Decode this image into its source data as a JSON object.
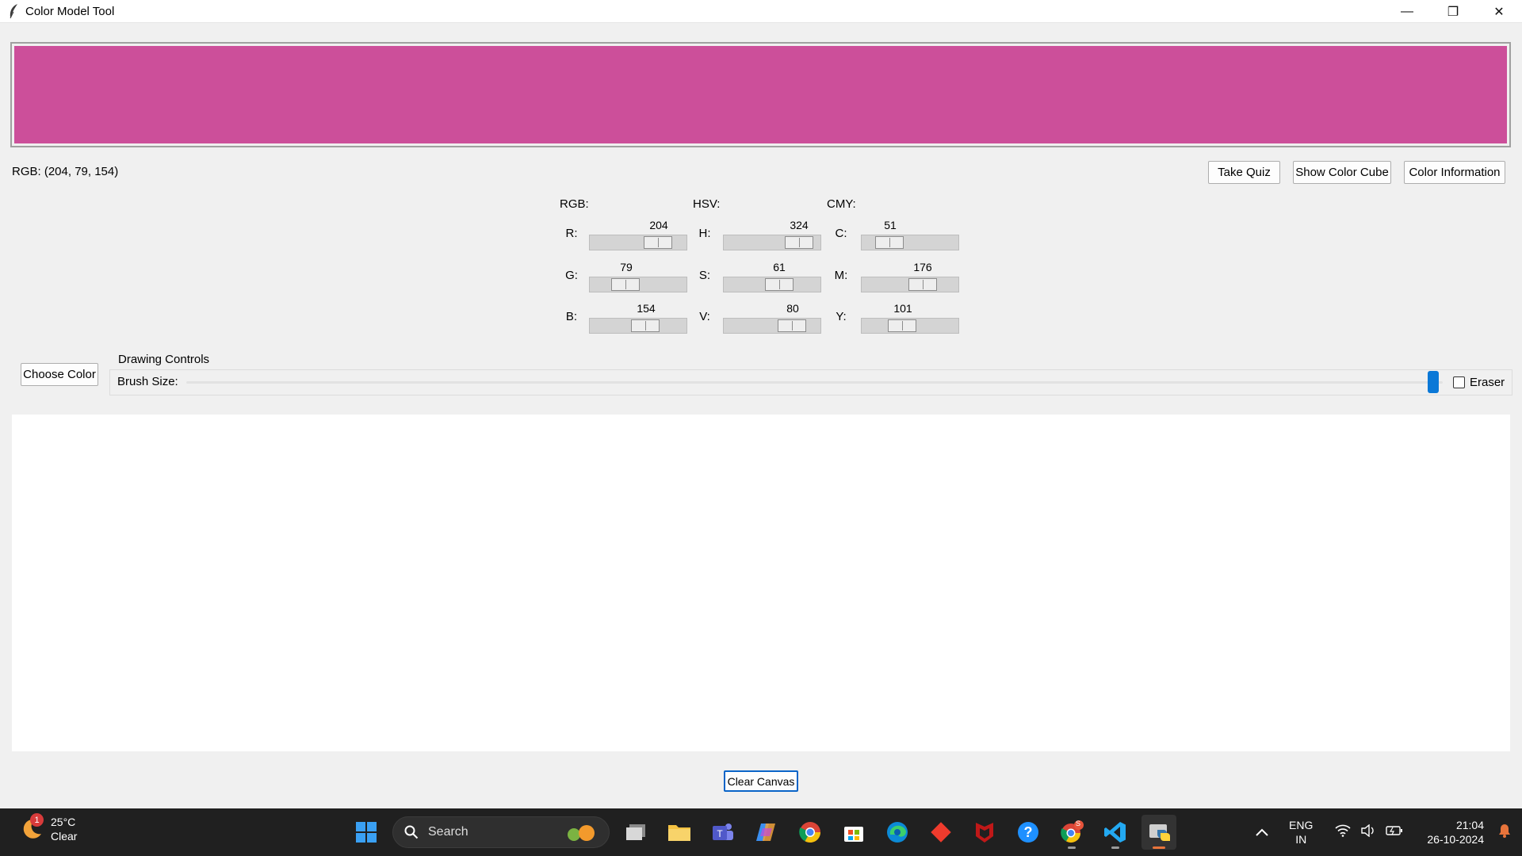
{
  "window": {
    "title": "Color Model Tool",
    "minimize": "—",
    "maximize": "❐",
    "close": "✕"
  },
  "color": {
    "hex": "#cc4f9a",
    "rgb_text": "RGB: (204, 79, 154)"
  },
  "buttons": {
    "take_quiz": "Take Quiz",
    "show_cube": "Show Color Cube",
    "color_info": "Color Information",
    "choose_color": "Choose Color",
    "clear_canvas": "Clear Canvas"
  },
  "groups": {
    "rgb": {
      "title": "RGB:",
      "rows": [
        {
          "label": "R:",
          "value": "204"
        },
        {
          "label": "G:",
          "value": "79"
        },
        {
          "label": "B:",
          "value": "154"
        }
      ]
    },
    "hsv": {
      "title": "HSV:",
      "rows": [
        {
          "label": "H:",
          "value": "324"
        },
        {
          "label": "S:",
          "value": "61"
        },
        {
          "label": "V:",
          "value": "80"
        }
      ]
    },
    "cmy": {
      "title": "CMY:",
      "rows": [
        {
          "label": "C:",
          "value": "51"
        },
        {
          "label": "M:",
          "value": "176"
        },
        {
          "label": "Y:",
          "value": "101"
        }
      ]
    }
  },
  "drawing": {
    "title": "Drawing Controls",
    "brush_label": "Brush Size:",
    "eraser_label": "Eraser",
    "brush_fraction": 1.0
  },
  "taskbar": {
    "weather_temp": "25°C",
    "weather_cond": "Clear",
    "weather_badge": "1",
    "search_placeholder": "Search",
    "lang_top": "ENG",
    "lang_bottom": "IN",
    "time": "21:04",
    "date": "26-10-2024",
    "chrome_badge": "S"
  }
}
